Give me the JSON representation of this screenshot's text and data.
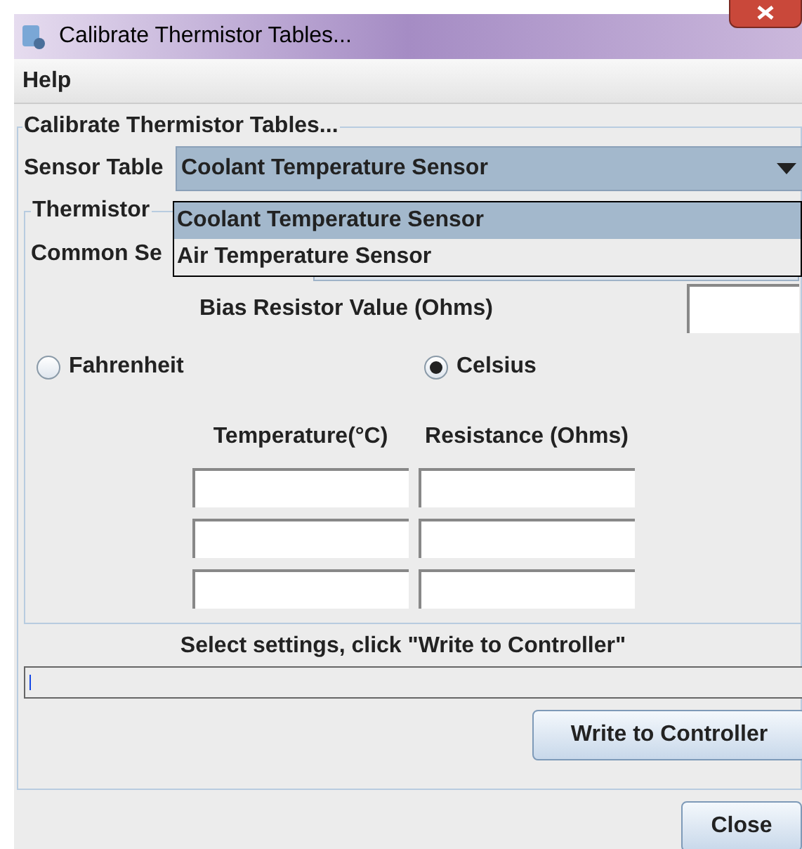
{
  "window": {
    "title": "Calibrate Thermistor Tables..."
  },
  "menu": [
    {
      "label": "Help"
    }
  ],
  "group": {
    "title": "Calibrate Thermistor Tables..."
  },
  "sensor_table": {
    "label": "Sensor Table",
    "value": "Coolant Temperature Sensor",
    "expanded": true,
    "options": [
      {
        "label": "Coolant Temperature Sensor",
        "selected": true
      },
      {
        "label": "Air Temperature Sensor",
        "selected": false
      }
    ]
  },
  "thermistor_group": {
    "title": "Thermistor",
    "common_sensor_label": "Common Se"
  },
  "bias": {
    "label": "Bias Resistor Value (Ohms)"
  },
  "units": [
    {
      "label": "Fahrenheit",
      "selected": false
    },
    {
      "label": "Celsius",
      "selected": true
    }
  ],
  "table": {
    "columns": [
      "Temperature(°C)",
      "Resistance (Ohms)"
    ],
    "rows": [
      {
        "editable": true
      },
      {
        "editable": true
      },
      {
        "editable": true
      }
    ]
  },
  "status": {
    "message": "Select settings, click \"Write to Controller\"",
    "focused": true
  },
  "buttons": {
    "write": "Write to Controller",
    "close": "Close"
  }
}
